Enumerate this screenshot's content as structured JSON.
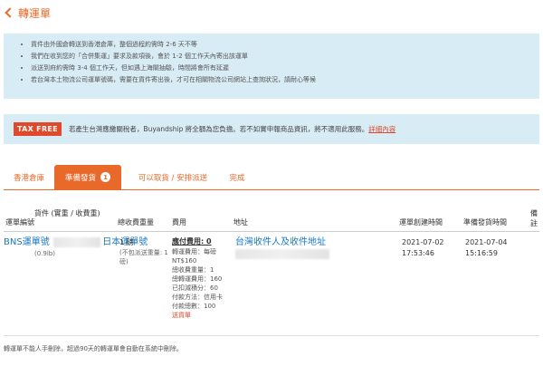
{
  "header": {
    "title": "轉運單"
  },
  "notice": {
    "items": [
      "貨件由外國倉轉送到香港倉庫，整個過程約需時 2-6 天不等",
      "我們在收到您的「合併集運」要求及款項後，會於 1-2 個工作天內寄出該運單",
      "派送到府約需時 3-4 個工作天，但如遇上海關抽驗，時間將會所有延遲",
      "若台灣本土物流公司運單號碼，需要在貨件寄出後，才可在相關物流公司網站上查詢狀況，請耐心等候"
    ]
  },
  "tax": {
    "badge": "TAX FREE",
    "text": "若產生台灣應繳關稅者，Buyandship 將全額為您負擔。若不如實申報商品資訊，將不適用此服務。",
    "link": "詳細內容"
  },
  "tabs": [
    {
      "label": "香港倉庫"
    },
    {
      "label": "準備發貨",
      "count": "1"
    },
    {
      "label": "可以取貨 / 安排派送"
    },
    {
      "label": "完成"
    }
  ],
  "table": {
    "headers": {
      "waybill": "運單編號",
      "items": "貨件 (實重 / 收費重)",
      "weight": "總收費重量",
      "fee": "費用",
      "address": "地址",
      "created": "運單創建時間",
      "prepared": "準備發貨時間",
      "remark": "備註"
    },
    "row": {
      "bns_waybill": "BNS運單號",
      "jp_waybill": "日本運單號",
      "item_weight": "(0.9lb)",
      "weight_main": "1 磅",
      "weight_note": "(不包派送重量: 1磅)",
      "fee_title": "應付費用: 0",
      "fee_lines": [
        "轉運費用：每磅",
        "NT$160",
        "總收費重量：1",
        "總轉運費用：160",
        "已扣減積分：60",
        "付款方法：信用卡",
        "付款總數：100"
      ],
      "fee_link": "送貨單",
      "address": "台灣收件人及收件地址",
      "created_date": "2021-07-02",
      "created_time": "17:53:46",
      "prepared_date": "2021-07-04",
      "prepared_time": "15:16:59"
    }
  },
  "footer": {
    "note": "轉運單不能人手刪除，超過90天的轉運單會自動在系統中刪除。"
  },
  "colors": {
    "accent": "#e8692a",
    "notice_bg": "#d8ecf6",
    "link": "#1a78c2",
    "tax_red": "#e04a2b"
  },
  "icons": {
    "back": "chevron-left-icon"
  }
}
